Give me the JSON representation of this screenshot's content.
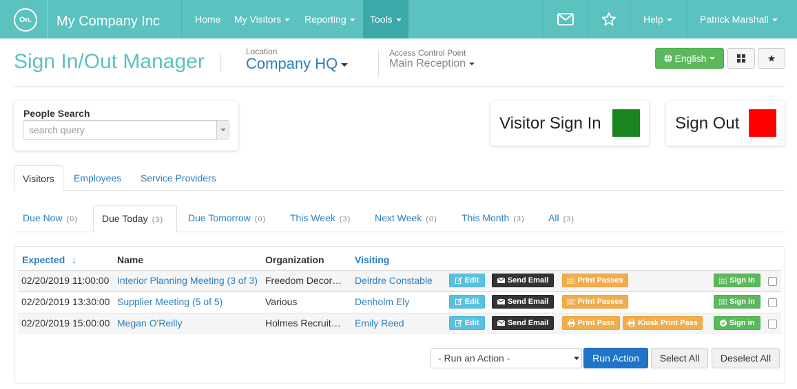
{
  "colors": {
    "brand": "#5bc2c0",
    "link": "#2a7fc1",
    "success": "#5cb85c",
    "signin_swatch": "#1a8420",
    "signout_swatch": "#ff0000"
  },
  "topbar": {
    "logo_text": "On.",
    "company": "My Company Inc",
    "nav": {
      "home": "Home",
      "my_visitors": "My Visitors",
      "reporting": "Reporting",
      "tools": "Tools",
      "help": "Help",
      "user": "Patrick Marshall"
    },
    "icons": [
      "envelope-icon",
      "star-outline-icon"
    ]
  },
  "header": {
    "title": "Sign In/Out Manager",
    "location_label": "Location",
    "location_value": "Company HQ",
    "acp_label": "Access Control Point",
    "acp_value": "Main Reception",
    "language": "English"
  },
  "search": {
    "label": "People Search",
    "placeholder": "search query"
  },
  "actions": {
    "visitor_sign_in": "Visitor Sign In",
    "sign_out": "Sign Out"
  },
  "tabs": {
    "primary": [
      "Visitors",
      "Employees",
      "Service Providers"
    ],
    "secondary": [
      {
        "label": "Due Now",
        "count": "(0)"
      },
      {
        "label": "Due Today",
        "count": "(3)"
      },
      {
        "label": "Due Tomorrow",
        "count": "(0)"
      },
      {
        "label": "This Week",
        "count": "(3)"
      },
      {
        "label": "Next Week",
        "count": "(0)"
      },
      {
        "label": "This Month",
        "count": "(3)"
      },
      {
        "label": "All",
        "count": "(3)"
      }
    ]
  },
  "table": {
    "headers": {
      "expected": "Expected",
      "sort_arrow": "↓",
      "name": "Name",
      "organization": "Organization",
      "visiting": "Visiting"
    },
    "rows": [
      {
        "expected": "02/20/2019 11:00:00",
        "name": "Interior Planning Meeting (3 of 3)",
        "organization": "Freedom Decorators",
        "visiting": "Deirdre Constable",
        "print1": "Print Passes",
        "print2": "",
        "sign": "Sign in"
      },
      {
        "expected": "02/20/2019 13:30:00",
        "name": "Supplier Meeting (5 of 5)",
        "organization": "Various",
        "visiting": "Denholm Ely",
        "print1": "Print Passes",
        "print2": "",
        "sign": "Sign in"
      },
      {
        "expected": "02/20/2019 15:00:00",
        "name": "Megan O'Reilly",
        "organization": "Holmes Recruitment",
        "visiting": "Emily Reed",
        "print1": "Print Pass",
        "print2": "Kiosk Print Pass",
        "sign": "Sign in"
      }
    ],
    "edit_label": "Edit",
    "email_label": "Send Email"
  },
  "footer": {
    "action_select": "- Run an Action -",
    "run_action": "Run Action",
    "select_all": "Select All",
    "deselect_all": "Deselect All"
  }
}
